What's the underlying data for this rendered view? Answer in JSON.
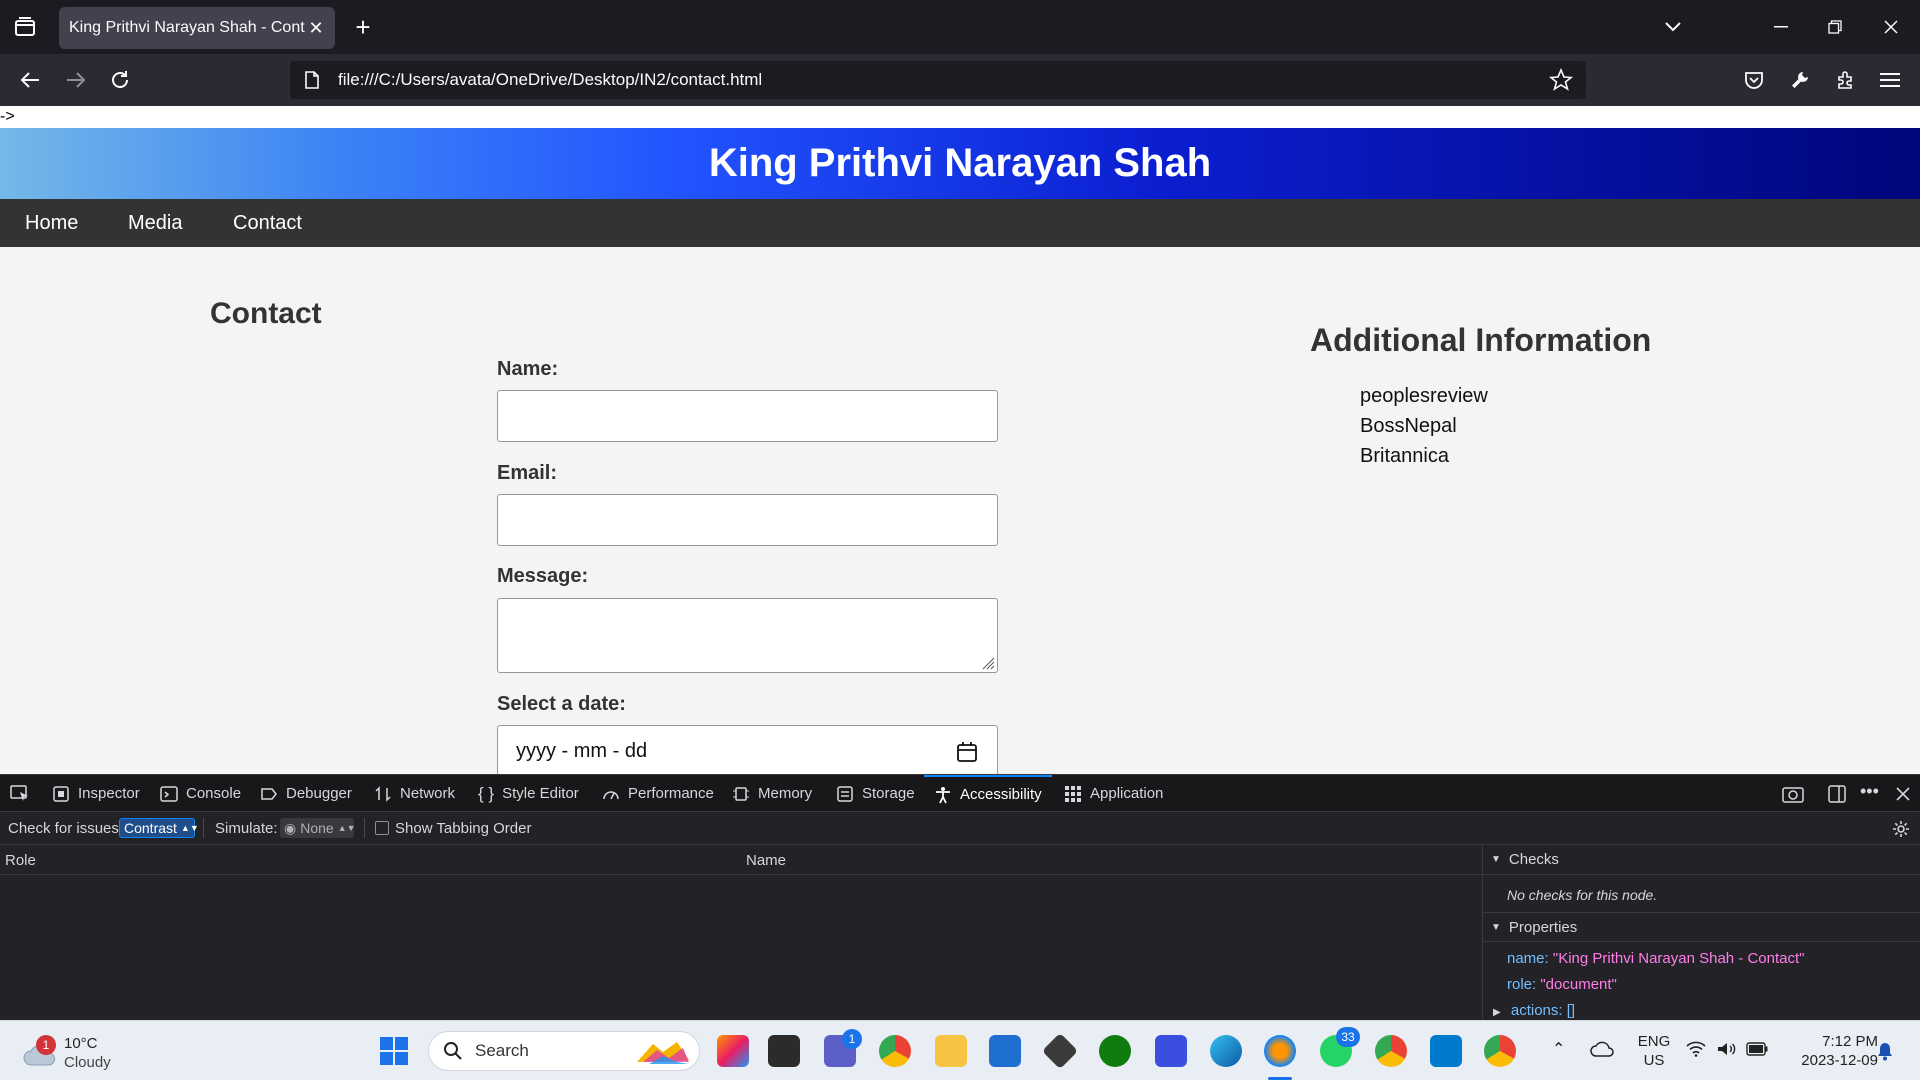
{
  "browser": {
    "tab_title": "King Prithvi Narayan Shah - Contact",
    "url": "file:///C:/Users/avata/OneDrive/Desktop/IN2/contact.html"
  },
  "page": {
    "stray_text": "->",
    "header_title": "King Prithvi Narayan Shah",
    "nav": [
      "Home",
      "Media",
      "Contact"
    ],
    "contact_heading": "Contact",
    "form": {
      "name_label": "Name:",
      "email_label": "Email:",
      "message_label": "Message:",
      "date_label": "Select a date:",
      "date_placeholder": "yyyy - mm - dd"
    },
    "additional": {
      "heading": "Additional Information",
      "links": [
        "peoplesreview",
        "BossNepal",
        "Britannica"
      ]
    }
  },
  "devtools": {
    "tabs": [
      "Inspector",
      "Console",
      "Debugger",
      "Network",
      "Style Editor",
      "Performance",
      "Memory",
      "Storage",
      "Accessibility",
      "Application"
    ],
    "active_tab": "Accessibility",
    "check_label": "Check for issues:",
    "check_value": "Contrast",
    "simulate_label": "Simulate:",
    "simulate_value": "None",
    "tabbing_label": "Show Tabbing Order",
    "col_role": "Role",
    "col_name": "Name",
    "checks_title": "Checks",
    "checks_empty": "No checks for this node.",
    "properties_title": "Properties",
    "props": {
      "name_key": "name:",
      "name_val": "\"King Prithvi Narayan Shah - Contact\"",
      "role_key": "role:",
      "role_val": "\"document\"",
      "actions_key": "actions:",
      "actions_val": "[]"
    }
  },
  "taskbar": {
    "weather_temp": "10°C",
    "weather_desc": "Cloudy",
    "weather_badge": "1",
    "search_placeholder": "Search",
    "teams_badge": "1",
    "whatsapp_badge": "33",
    "lang_top": "ENG",
    "lang_bottom": "US",
    "time": "7:12 PM",
    "date": "2023-12-09"
  },
  "colors": {
    "accent": "#0a84ff",
    "header_gradient_start": "#74b9e7",
    "header_gradient_end": "#01057a",
    "nav_bg": "#333333"
  }
}
